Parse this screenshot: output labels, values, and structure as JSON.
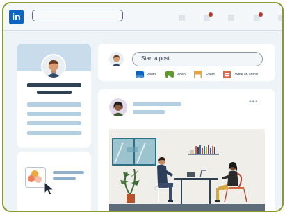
{
  "nav": {
    "logo_text": "in",
    "brand_color": "#0a66c2",
    "notification_color": "#b4372a"
  },
  "composer": {
    "placeholder": "Start a post",
    "actions": [
      {
        "label": "Photo",
        "icon": "photo-icon",
        "color": "#0a66c2"
      },
      {
        "label": "Video",
        "icon": "video-icon",
        "color": "#5f9b2c"
      },
      {
        "label": "Event",
        "icon": "event-icon",
        "color": "#e7a33e"
      },
      {
        "label": "Write an article",
        "icon": "article-icon",
        "color": "#e06847"
      }
    ]
  },
  "post": {
    "menu_glyph": "•••"
  }
}
